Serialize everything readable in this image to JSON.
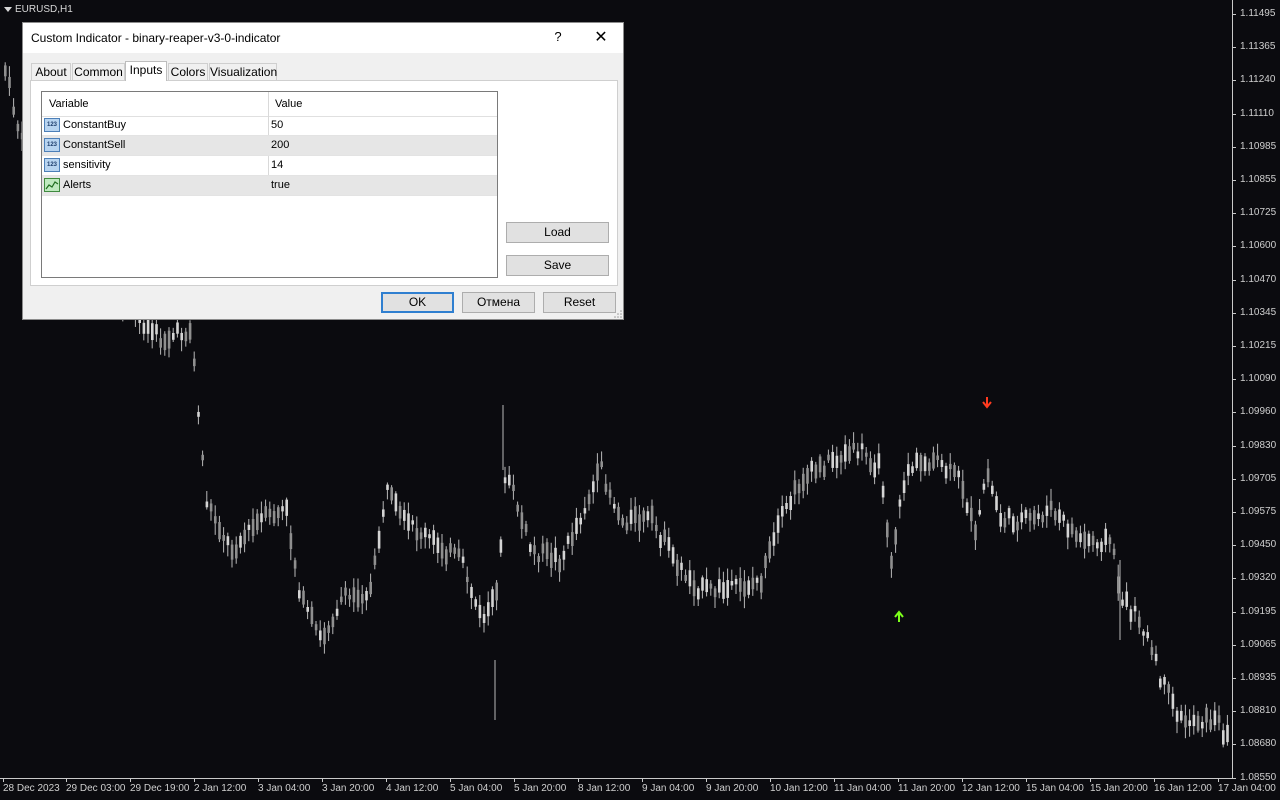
{
  "chart": {
    "symbol_label": "EURUSD,H1",
    "price_axis": [
      "1.11495",
      "1.11365",
      "1.11240",
      "1.11110",
      "1.10985",
      "1.10855",
      "1.10725",
      "1.10600",
      "1.10470",
      "1.10345",
      "1.10215",
      "1.10090",
      "1.09960",
      "1.09830",
      "1.09705",
      "1.09575",
      "1.09450",
      "1.09320",
      "1.09195",
      "1.09065",
      "1.08935",
      "1.08810",
      "1.08680",
      "1.08550"
    ],
    "time_axis": [
      "28 Dec 2023",
      "29 Dec 03:00",
      "29 Dec 19:00",
      "2 Jan 12:00",
      "3 Jan 04:00",
      "3 Jan 20:00",
      "4 Jan 12:00",
      "5 Jan 04:00",
      "5 Jan 20:00",
      "8 Jan 12:00",
      "9 Jan 04:00",
      "9 Jan 20:00",
      "10 Jan 12:00",
      "11 Jan 04:00",
      "11 Jan 20:00",
      "12 Jan 12:00",
      "15 Jan 04:00",
      "15 Jan 20:00",
      "16 Jan 12:00",
      "17 Jan 04:00"
    ],
    "sell_arrow_color": "#ff3b1f",
    "buy_arrow_color": "#7cff1a",
    "candle_color": "#b8b8b8"
  },
  "dialog": {
    "title": "Custom Indicator - binary-reaper-v3-0-indicator",
    "help_label": "?",
    "close_label": "✕",
    "tabs": [
      "About",
      "Common",
      "Inputs",
      "Colors",
      "Visualization"
    ],
    "active_tab": "Inputs",
    "grid": {
      "col_variable": "Variable",
      "col_value": "Value",
      "rows": [
        {
          "icon": "123",
          "variable": "ConstantBuy",
          "value": "50"
        },
        {
          "icon": "123",
          "variable": "ConstantSell",
          "value": "200"
        },
        {
          "icon": "123",
          "variable": "sensitivity",
          "value": "14"
        },
        {
          "icon": "alert-icon",
          "variable": "Alerts",
          "value": "true"
        }
      ]
    },
    "load_label": "Load",
    "save_label": "Save",
    "ok_label": "OK",
    "cancel_label": "Отмена",
    "reset_label": "Reset"
  }
}
